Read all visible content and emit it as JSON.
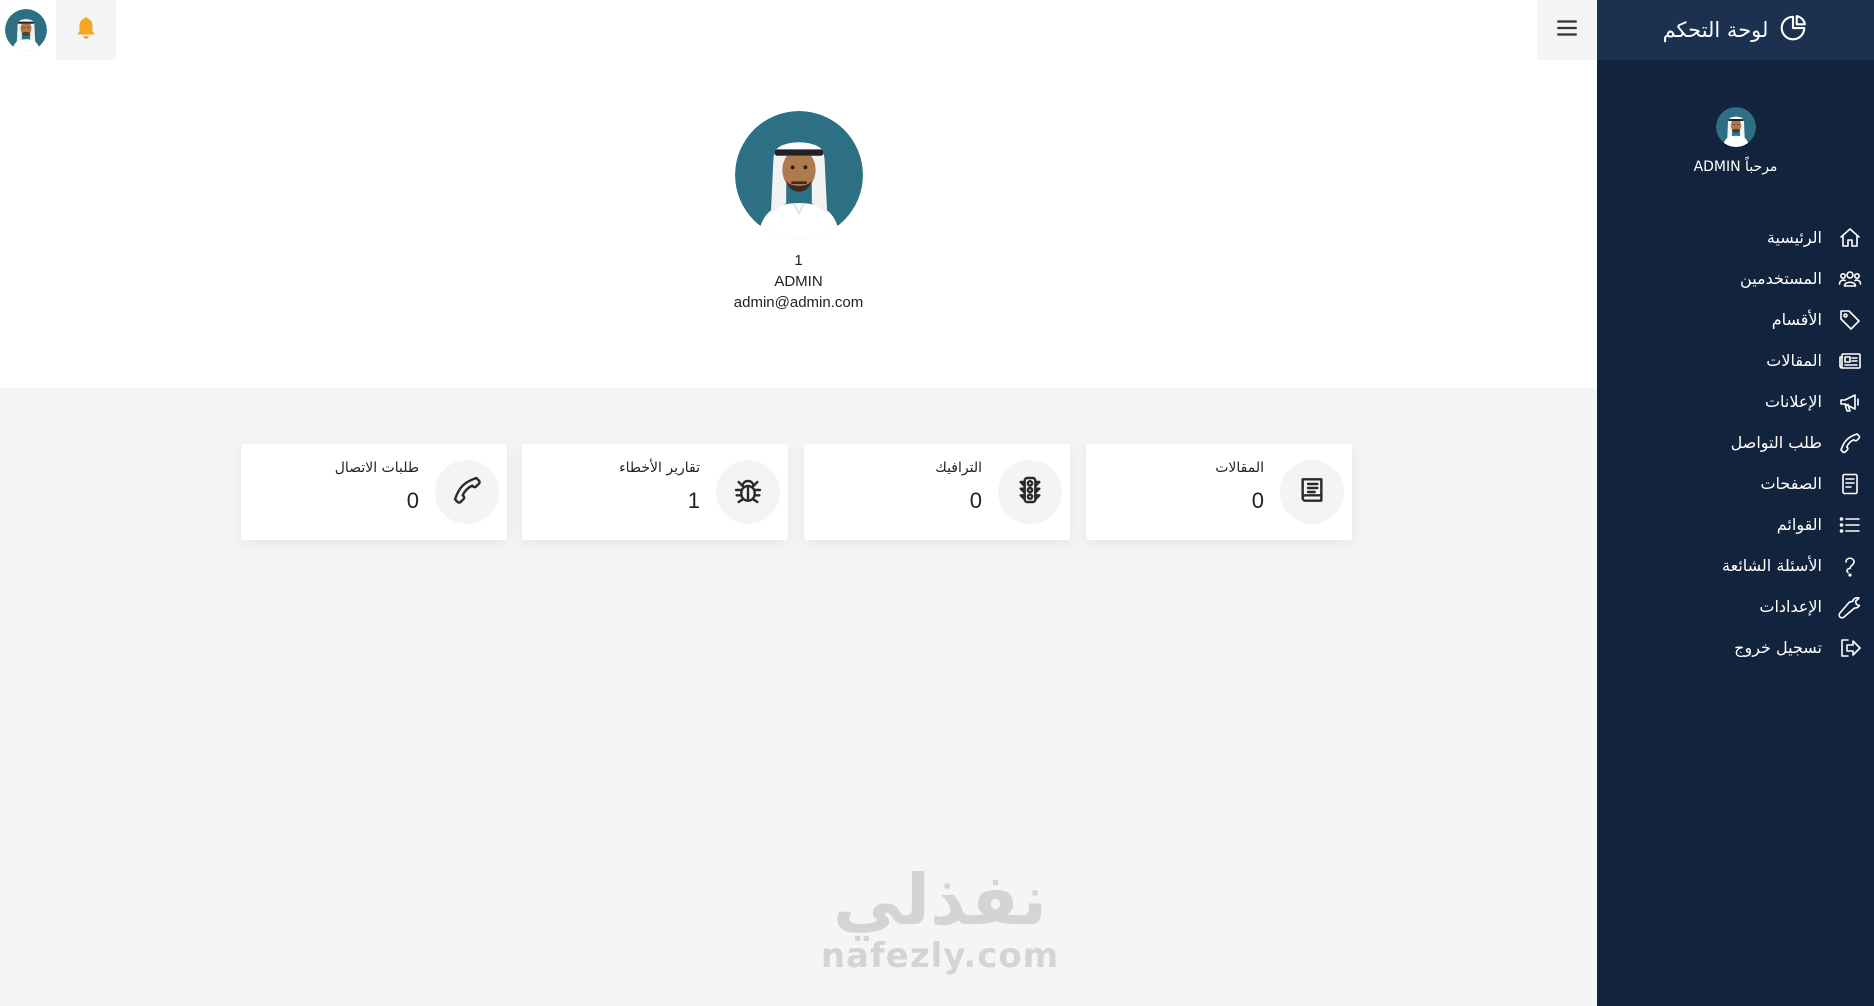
{
  "app": {
    "title": "لوحة التحكم"
  },
  "sidebar": {
    "welcome": "مرحباً ADMIN",
    "items": [
      {
        "label": "الرئيسية",
        "icon": "home-icon"
      },
      {
        "label": "المستخدمين",
        "icon": "users-icon"
      },
      {
        "label": "الأقسام",
        "icon": "tag-icon"
      },
      {
        "label": "المقالات",
        "icon": "newspaper-icon"
      },
      {
        "label": "الإعلانات",
        "icon": "megaphone-icon"
      },
      {
        "label": "طلب التواصل",
        "icon": "phone-icon"
      },
      {
        "label": "الصفحات",
        "icon": "file-icon"
      },
      {
        "label": "القوائم",
        "icon": "list-icon"
      },
      {
        "label": "الأسئلة الشائعة",
        "icon": "question-icon"
      },
      {
        "label": "الإعدادات",
        "icon": "wrench-icon"
      },
      {
        "label": "تسجيل خروج",
        "icon": "logout-icon"
      }
    ]
  },
  "profile": {
    "id": "1",
    "name": "ADMIN",
    "email": "admin@admin.com"
  },
  "stats": [
    {
      "title": "المقالات",
      "value": "0",
      "icon": "book-icon"
    },
    {
      "title": "الترافيك",
      "value": "0",
      "icon": "traffic-light-icon"
    },
    {
      "title": "تقارير الأخطاء",
      "value": "1",
      "icon": "bug-icon"
    },
    {
      "title": "طلبات الاتصال",
      "value": "0",
      "icon": "phone-icon"
    }
  ],
  "watermark": {
    "arabic": "نفذلي",
    "latin": "nafezly.com"
  },
  "colors": {
    "sidebar_bg": "#12233d",
    "sidebar_header_bg": "#1c3150",
    "bell": "#f5a623",
    "avatar_bg": "#2e7083"
  }
}
